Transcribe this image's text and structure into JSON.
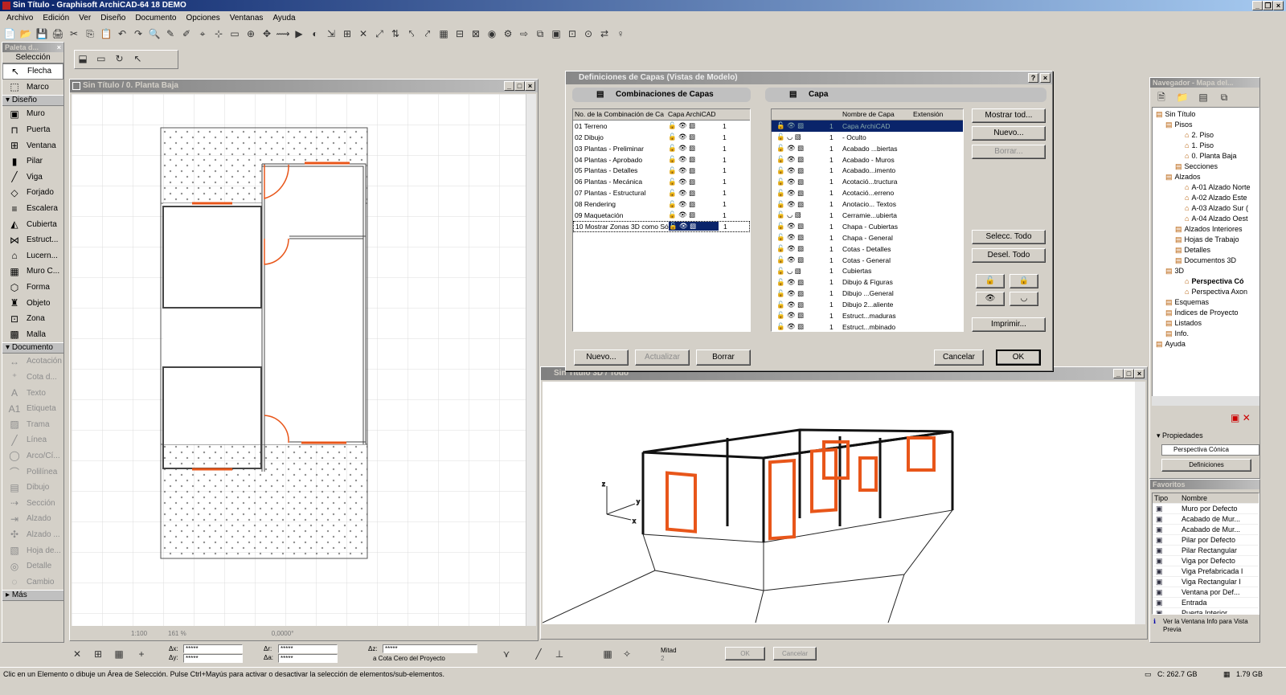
{
  "app": {
    "title": "Sin Título - Graphisoft ArchiCAD-64 18 DEMO"
  },
  "menu": [
    "Archivo",
    "Edición",
    "Ver",
    "Diseño",
    "Documento",
    "Opciones",
    "Ventanas",
    "Ayuda"
  ],
  "palette": {
    "title": "Paleta d...",
    "selection_label": "Selección",
    "seleccion": [
      {
        "label": "Flecha",
        "icon": "↖"
      },
      {
        "label": "Marco",
        "icon": "⬚"
      }
    ],
    "diseno_header": "Diseño",
    "diseno": [
      {
        "label": "Muro",
        "icon": "▣"
      },
      {
        "label": "Puerta",
        "icon": "⊓"
      },
      {
        "label": "Ventana",
        "icon": "⊞"
      },
      {
        "label": "Pilar",
        "icon": "▮"
      },
      {
        "label": "Viga",
        "icon": "╱"
      },
      {
        "label": "Forjado",
        "icon": "◇"
      },
      {
        "label": "Escalera",
        "icon": "≡"
      },
      {
        "label": "Cubierta",
        "icon": "◭"
      },
      {
        "label": "Estruct...",
        "icon": "⋈"
      },
      {
        "label": "Lucern...",
        "icon": "⌂"
      },
      {
        "label": "Muro C...",
        "icon": "▦"
      },
      {
        "label": "Forma",
        "icon": "⬡"
      },
      {
        "label": "Objeto",
        "icon": "♜"
      },
      {
        "label": "Zona",
        "icon": "⊡"
      },
      {
        "label": "Malla",
        "icon": "▩"
      }
    ],
    "documento_header": "Documento",
    "documento": [
      {
        "label": "Acotación",
        "icon": "↔"
      },
      {
        "label": "Cota d...",
        "icon": "⁺"
      },
      {
        "label": "Texto",
        "icon": "A"
      },
      {
        "label": "Etiqueta",
        "icon": "A1"
      },
      {
        "label": "Trama",
        "icon": "▨"
      },
      {
        "label": "Línea",
        "icon": "╱"
      },
      {
        "label": "Arco/Cí...",
        "icon": "◯"
      },
      {
        "label": "Polilínea",
        "icon": "⌒"
      },
      {
        "label": "Dibujo",
        "icon": "▤"
      },
      {
        "label": "Sección",
        "icon": "⇢"
      },
      {
        "label": "Alzado",
        "icon": "⇥"
      },
      {
        "label": "Alzado ...",
        "icon": "✣"
      },
      {
        "label": "Hoja de...",
        "icon": "▧"
      },
      {
        "label": "Detalle",
        "icon": "◎"
      },
      {
        "label": "Cambio",
        "icon": "◌"
      }
    ],
    "mas": "Más"
  },
  "plan_window": {
    "title": "Sin Título / 0. Planta Baja",
    "scale": "1:100",
    "zoom": "161 %",
    "angle": "0,0000°"
  },
  "dialog": {
    "title": "Definiciones de Capas (Vistas de Modelo)",
    "combos_header": "Combinaciones de Capas",
    "combos_columns": [
      "No. de la Combinación de Ca",
      "Capa ArchiCAD"
    ],
    "combos": [
      "01 Terreno",
      "02 Dibujo",
      "03 Plantas - Preliminar",
      "04 Plantas - Aprobado",
      "05 Plantas - Detalles",
      "06 Plantas - Mecánica",
      "07 Plantas - Estructural",
      "08 Rendering",
      "09 Maquetación",
      "10 Mostrar Zonas 3D como Só"
    ],
    "combo_num": "1",
    "layers_header": "Capa",
    "layers_columns": [
      "Nombre de Capa",
      "Extensión"
    ],
    "layers": [
      "Capa ArchiCAD",
      "- Oculto",
      "Acabado ...biertas",
      "Acabado - Muros",
      "Acabado...imento",
      "Acotació...tructura",
      "Acotació...erreno",
      "Anotacio... Textos",
      "Cerramie...ubierta",
      "Chapa - Cubiertas",
      "Chapa - General",
      "Cotas - Detalles",
      "Cotas - General",
      "Cubiertas",
      "Dibujo & Figuras",
      "Dibujo ...General",
      "Dibujo 2...aliente",
      "Estruct...maduras",
      "Estruct...mbinado"
    ],
    "layer_num": "1",
    "buttons": {
      "mostrar": "Mostrar tod...",
      "nuevo": "Nuevo...",
      "borrar": "Borrar...",
      "selecc": "Selecc. Todo",
      "desel": "Desel. Todo",
      "imprimir": "Imprimir...",
      "c_nuevo": "Nuevo...",
      "c_actualizar": "Actualizar",
      "c_borrar": "Borrar",
      "cancelar": "Cancelar",
      "ok": "OK"
    }
  },
  "view3d": {
    "title": "Sin Título 3D / Todo"
  },
  "navigator": {
    "title": "Navegador - Mapa del...",
    "tree": [
      {
        "t": "Sin Título",
        "d": 0
      },
      {
        "t": "Pisos",
        "d": 1
      },
      {
        "t": "2. Piso",
        "d": 3
      },
      {
        "t": "1. Piso",
        "d": 3
      },
      {
        "t": "0. Planta Baja",
        "d": 3
      },
      {
        "t": "Secciones",
        "d": 2
      },
      {
        "t": "Alzados",
        "d": 1
      },
      {
        "t": "A-01 Alzado Norte",
        "d": 3
      },
      {
        "t": "A-02 Alzado Este",
        "d": 3
      },
      {
        "t": "A-03 Alzado Sur (",
        "d": 3
      },
      {
        "t": "A-04 Alzado Oest",
        "d": 3
      },
      {
        "t": "Alzados Interiores",
        "d": 2
      },
      {
        "t": "Hojas de Trabajo",
        "d": 2
      },
      {
        "t": "Detalles",
        "d": 2
      },
      {
        "t": "Documentos 3D",
        "d": 2
      },
      {
        "t": "3D",
        "d": 1
      },
      {
        "t": "Perspectiva Có",
        "d": 3
      },
      {
        "t": "Perspectiva Axon",
        "d": 3
      },
      {
        "t": "Esquemas",
        "d": 1
      },
      {
        "t": "Índices de Proyecto",
        "d": 1
      },
      {
        "t": "Listados",
        "d": 1
      },
      {
        "t": "Info.",
        "d": 1
      },
      {
        "t": "Ayuda",
        "d": 0
      }
    ],
    "props_header": "Propiedades",
    "props_value": "Perspectiva Cónica",
    "defs_button": "Definiciones"
  },
  "favoritos": {
    "title": "Favoritos",
    "columns": [
      "Tipo",
      "Nombre"
    ],
    "items": [
      "Muro por Defecto",
      "Acabado de Mur...",
      "Acabado de Mur...",
      "Pilar por Defecto",
      "Pilar Rectangular",
      "Viga por Defecto",
      "Viga Prefabricada I",
      "Viga Rectangular I",
      "Ventana por Def...",
      "Entrada",
      "Puerta Interior"
    ],
    "info": "Ver la Ventana Info para Vista Previa"
  },
  "coordbar": {
    "x_label": "Δx:",
    "x_val": "*****",
    "y_label": "Δy:",
    "y_val": "*****",
    "r_label": "Δr:",
    "r_val": "*****",
    "a_label": "Δa:",
    "a_val": "*****",
    "z_label": "Δz:",
    "z_val": "*****",
    "z_ref": "a Cota Cero del Proyecto",
    "mitad": "Mitad",
    "mitad_val": "2",
    "ok": "OK",
    "cancel": "Cancelar"
  },
  "status": {
    "hint": "Clic en un Elemento o dibuje un Área de Selección. Pulse Ctrl+Mayús para activar o desactivar la selección de elementos/sub-elementos.",
    "disk": "C: 262.7 GB",
    "mem": "1.79 GB"
  },
  "colors": {
    "titlebar": "#0a246a",
    "door": "#e8561a",
    "grid": "#dcdcdc"
  }
}
